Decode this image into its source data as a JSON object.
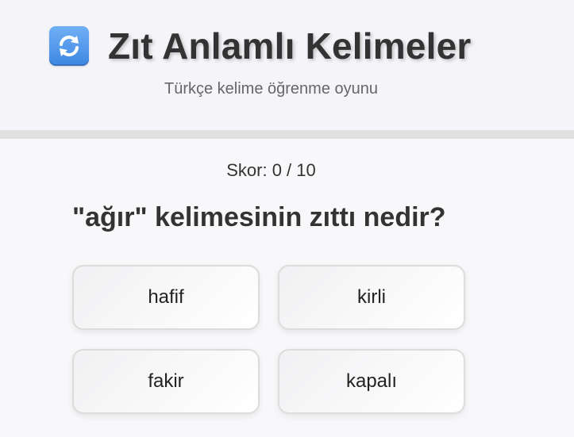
{
  "header": {
    "icon": "counterclockwise-arrows-icon",
    "title": "Zıt Anlamlı Kelimeler",
    "subtitle": "Türkçe kelime öğrenme oyunu"
  },
  "game": {
    "score_text": "Skor: 0 / 10",
    "question": "\"ağır\" kelimesinin zıttı nedir?",
    "options": [
      {
        "label": "hafif"
      },
      {
        "label": "kirli"
      },
      {
        "label": "fakir"
      },
      {
        "label": "kapalı"
      }
    ]
  },
  "colors": {
    "icon_blue": "#3e86e2",
    "text": "#333333",
    "divider": "#e0e0e0"
  }
}
